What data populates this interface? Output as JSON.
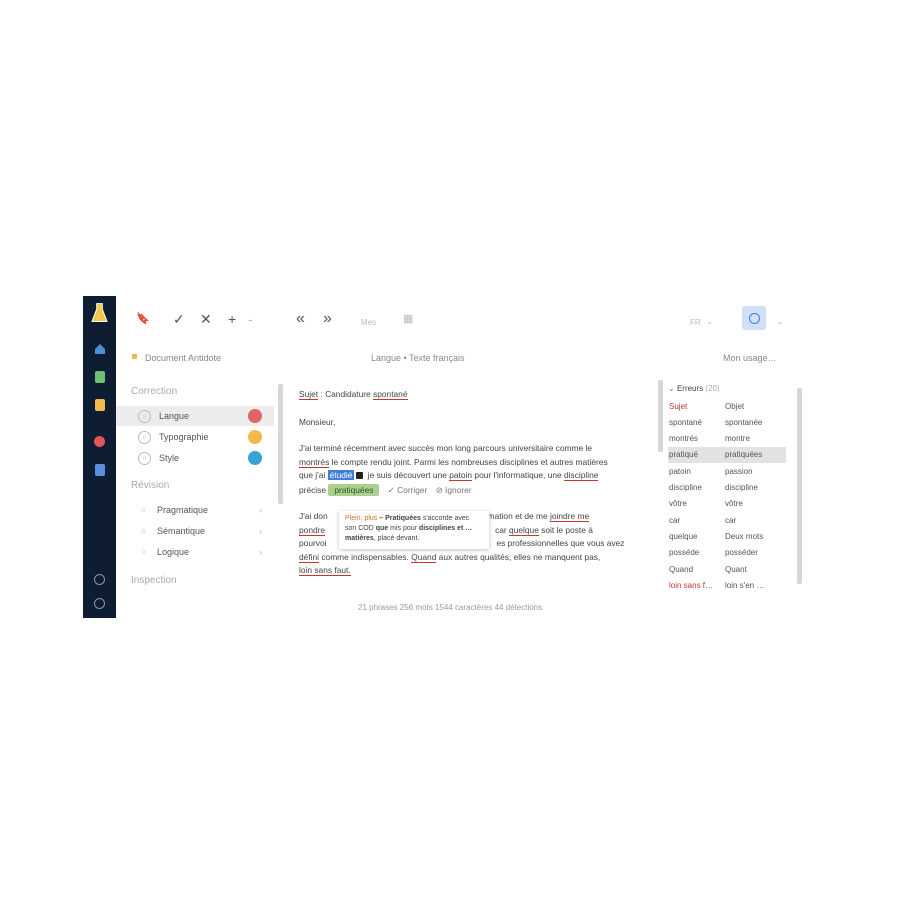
{
  "colors": {
    "navrail": "#0f1d33",
    "logo": "#f2c94c",
    "home": "#4a90d9",
    "note": "#6fbf73",
    "doc": "#f2b84b",
    "alert": "#e05656",
    "book": "#5b8fe0",
    "badge_red": "#e06666",
    "badge_orange": "#f2b84b",
    "badge_blue": "#3aa3d6"
  },
  "toolbar": {
    "bookmark_icon": "🔖",
    "check_icon": "✓",
    "close_icon": "✕",
    "add_icon": "+",
    "dash": "-",
    "prev_icon": "«",
    "next_icon": "»",
    "zoom_label": "Mes",
    "grid_icon": "▦",
    "lang_label": "FR",
    "dropdown_icon": "⌄"
  },
  "subheader": {
    "doc_title": "Document Antidote",
    "breadcrumb": "Langue • Texte français",
    "usage": "Mon usage…"
  },
  "sidebar": {
    "sections": [
      "Correction",
      "Révision",
      "Inspection"
    ],
    "correction_items": [
      "Langue",
      "Typographie",
      "Style"
    ],
    "revision_items": [
      "Pragmatique",
      "Sémantique",
      "Logique"
    ]
  },
  "editor": {
    "subject_label": "Sujet",
    "subject_rest": " : Candidature ",
    "subject_word": "spontané",
    "greeting": "Monsieur,",
    "p1_line1": "J'ai terminé récemment avec succès mon long parcours universitaire comme le",
    "p1_line2a": "montrés",
    "p1_line2b": " le compte rendu joint. Parmi les nombreuses disciplines et autres matières",
    "p1_line3a": "que j'ai ",
    "p1_sel": "étudié",
    "p1_line3b": " je suis découvert une ",
    "p1_word_passion": "patoin",
    "p1_line3c": " pour l'informatique, une ",
    "p1_word_discipline": "discipline",
    "p1_line4a": "précise",
    "btn_suggest": "pratiquées",
    "btn_correct": "✓ Corriger",
    "btn_ignore": "⊘ Ignorer",
    "tooltip_l1a": "Plein. plus",
    "tooltip_l1b": " – Pratiquées",
    "tooltip_l1c": " s'accorde avec",
    "tooltip_l2a": "son COD ",
    "tooltip_l2b": "que",
    "tooltip_l2c": " mis pour ",
    "tooltip_l2d": "disciplines et …",
    "tooltip_l3a": "matières",
    "tooltip_l3b": ", placé devant.",
    "p2_l1a": "J'ai don",
    "p2_l1b": "mation et de me ",
    "p2_l1c": "joindre me",
    "p2_l2a": "pondre",
    "p2_l2b": "car ",
    "p2_l2c": "quelque",
    "p2_l2d": " soit le poste à",
    "p2_l3a": "pourvoi",
    "p2_l3b": "es professionnelles que vous avez",
    "p2_l4a": "défini",
    "p2_l4b": " comme indispensables. ",
    "p2_l4c": "Quand",
    "p2_l4d": " aux autres qualités, elles ne manquent pas,",
    "p2_l5": "loin sans faut."
  },
  "status": {
    "text": "21 phrases   256 mots   1544 caractères   44 détections"
  },
  "panel": {
    "header_icon": "⌄",
    "header": "Erreurs",
    "count": "(20)",
    "rows": [
      [
        "Sujet",
        "Objet"
      ],
      [
        "spontané",
        "spontanée"
      ],
      [
        "montrés",
        "montre"
      ],
      [
        "pratiqué",
        "pratiquées"
      ],
      [
        "patoin",
        "passion"
      ],
      [
        "discipline",
        "discipline"
      ],
      [
        "vôtre",
        "vôtre"
      ],
      [
        "car",
        "car"
      ],
      [
        "quelque",
        "Deux mots"
      ],
      [
        "posséde",
        "posséder"
      ],
      [
        "Quand",
        "Quant"
      ],
      [
        "loin sans f…",
        "loin s'en …"
      ]
    ]
  }
}
